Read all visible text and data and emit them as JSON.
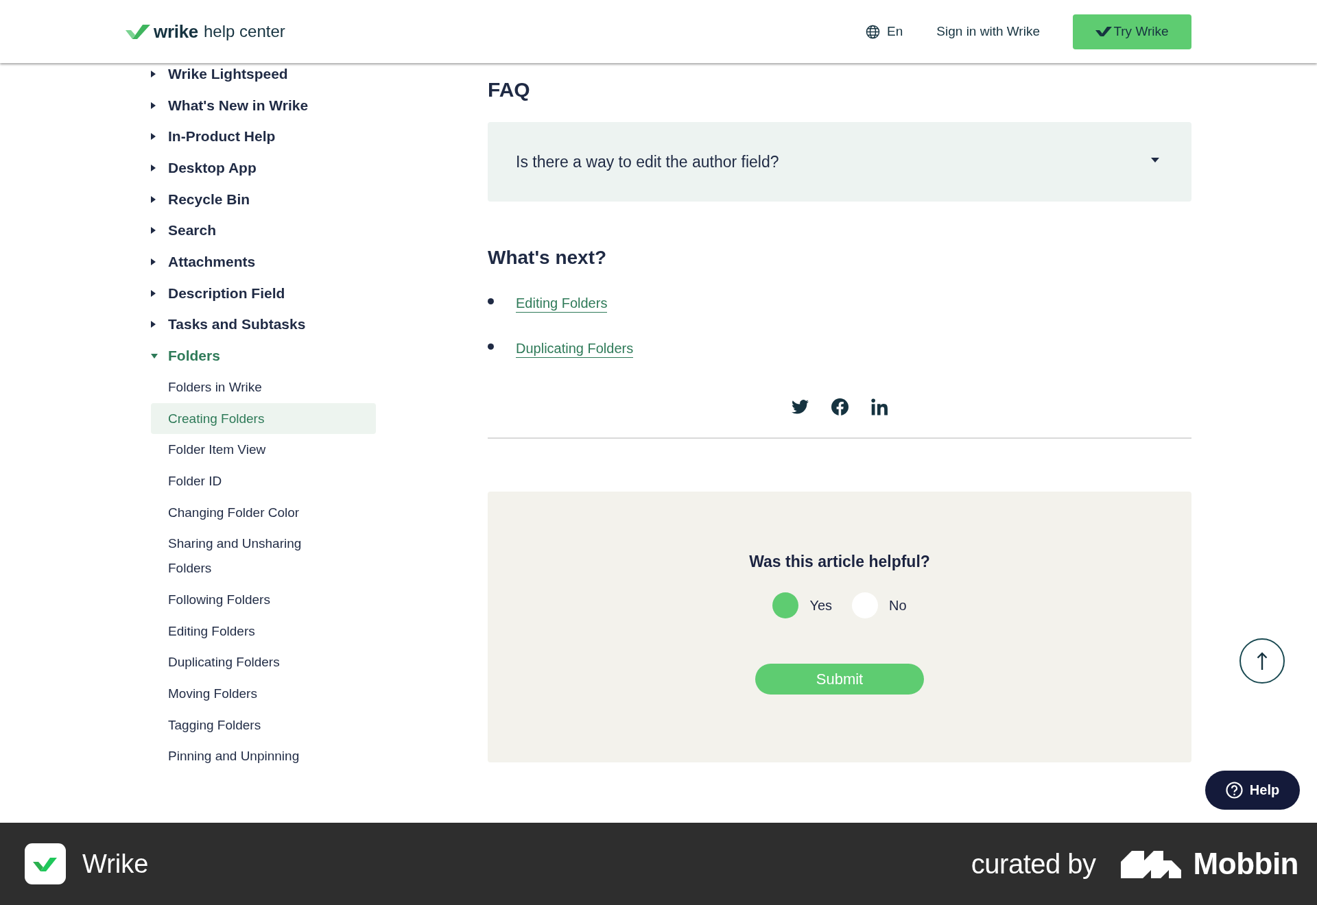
{
  "header": {
    "logo": {
      "name": "wrike",
      "suffix": "help center"
    },
    "language": "En",
    "sign_in": "Sign in with Wrike",
    "cta": "Try Wrike"
  },
  "sidebar": {
    "items": [
      {
        "label": "Wrike Lightspeed",
        "expanded": false,
        "selected": false
      },
      {
        "label": "What's New in Wrike",
        "expanded": false,
        "selected": false
      },
      {
        "label": "In-Product Help",
        "expanded": false,
        "selected": false
      },
      {
        "label": "Desktop App",
        "expanded": false,
        "selected": false
      },
      {
        "label": "Recycle Bin",
        "expanded": false,
        "selected": false
      },
      {
        "label": "Search",
        "expanded": false,
        "selected": false
      },
      {
        "label": "Attachments",
        "expanded": false,
        "selected": false
      },
      {
        "label": "Description Field",
        "expanded": false,
        "selected": false
      },
      {
        "label": "Tasks and Subtasks",
        "expanded": false,
        "selected": false
      },
      {
        "label": "Folders",
        "expanded": true,
        "selected": false,
        "children": [
          {
            "label": "Folders in Wrike",
            "selected": false
          },
          {
            "label": "Creating Folders",
            "selected": true
          },
          {
            "label": "Folder Item View",
            "selected": false
          },
          {
            "label": "Folder ID",
            "selected": false
          },
          {
            "label": "Changing Folder Color",
            "selected": false
          },
          {
            "label": "Sharing and Unsharing Folders",
            "selected": false
          },
          {
            "label": "Following Folders",
            "selected": false
          },
          {
            "label": "Editing Folders",
            "selected": false
          },
          {
            "label": "Duplicating Folders",
            "selected": false
          },
          {
            "label": "Moving Folders",
            "selected": false
          },
          {
            "label": "Tagging Folders",
            "selected": false
          },
          {
            "label": "Pinning and Unpinning",
            "selected": false
          }
        ]
      }
    ]
  },
  "main": {
    "faq": {
      "title": "FAQ",
      "items": [
        {
          "question": "Is there a way to edit the author field?",
          "expanded": false
        }
      ]
    },
    "whats_next": {
      "title": "What's next?",
      "links": [
        "Editing Folders",
        "Duplicating Folders"
      ]
    },
    "feedback": {
      "question": "Was this article helpful?",
      "options": [
        {
          "label": "Yes",
          "selected": true
        },
        {
          "label": "No",
          "selected": false
        }
      ],
      "submit": "Submit"
    }
  },
  "help_button": {
    "label": "Help"
  },
  "footer": {
    "app_name": "Wrike",
    "curated_by": "curated by",
    "brand": "Mobbin"
  }
}
